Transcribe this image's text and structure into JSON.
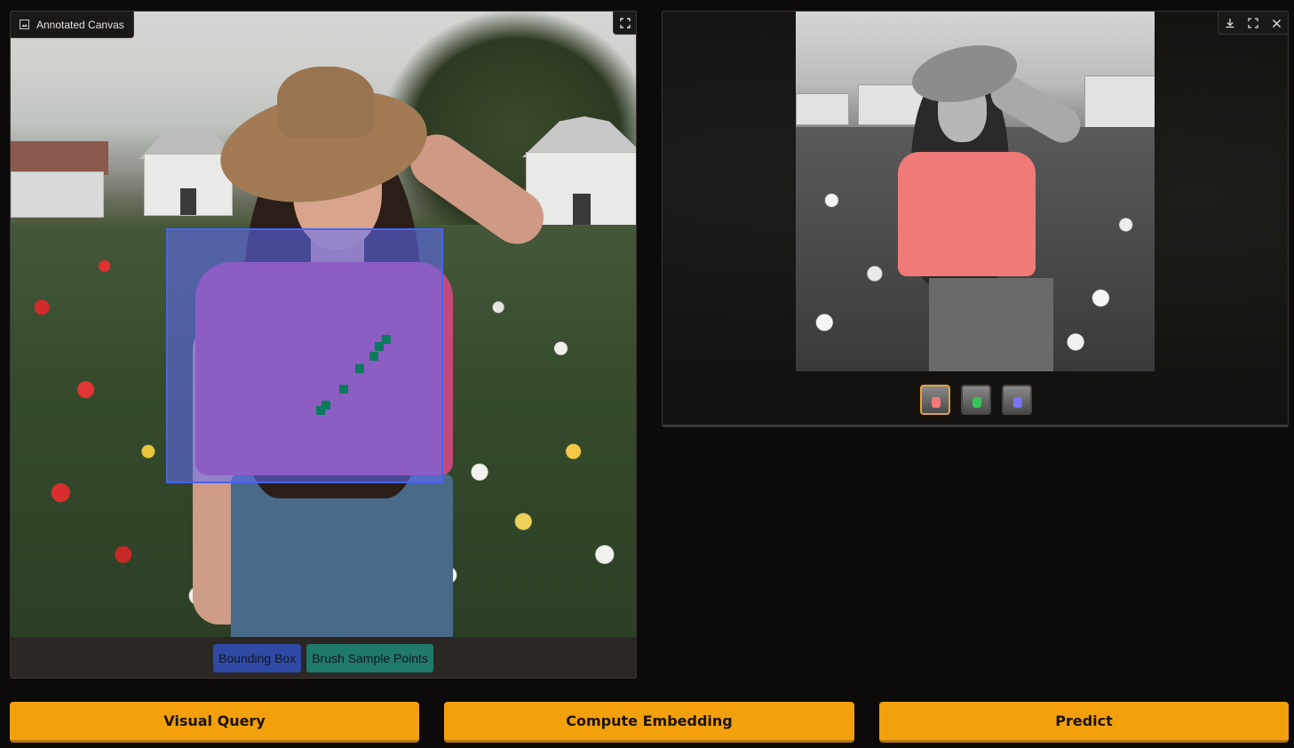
{
  "canvas_panel": {
    "label": "Annotated Canvas",
    "label_icon": "image-icon",
    "expand_icon": "fullscreen-icon"
  },
  "legend": {
    "items": [
      {
        "label": "Bounding Box",
        "color": "#2e4aa5"
      },
      {
        "label": "Brush Sample Points",
        "color": "#1f7a6a"
      }
    ]
  },
  "output_panel": {
    "toolbar_icons": [
      "download-icon",
      "fullscreen-icon",
      "close-icon"
    ],
    "thumbnails": [
      {
        "highlight_color": "#f07a78",
        "selected": true
      },
      {
        "highlight_color": "#39c35a",
        "selected": false
      },
      {
        "highlight_color": "#7b74f2",
        "selected": false
      }
    ]
  },
  "actions": {
    "visual_query": "Visual Query",
    "compute_embedding": "Compute Embedding",
    "predict": "Predict"
  },
  "colors": {
    "accent": "#f2a00c",
    "background": "#0d0b0a",
    "bbox_overlay": "#606eff",
    "brush_points": "#0b7a5e"
  }
}
